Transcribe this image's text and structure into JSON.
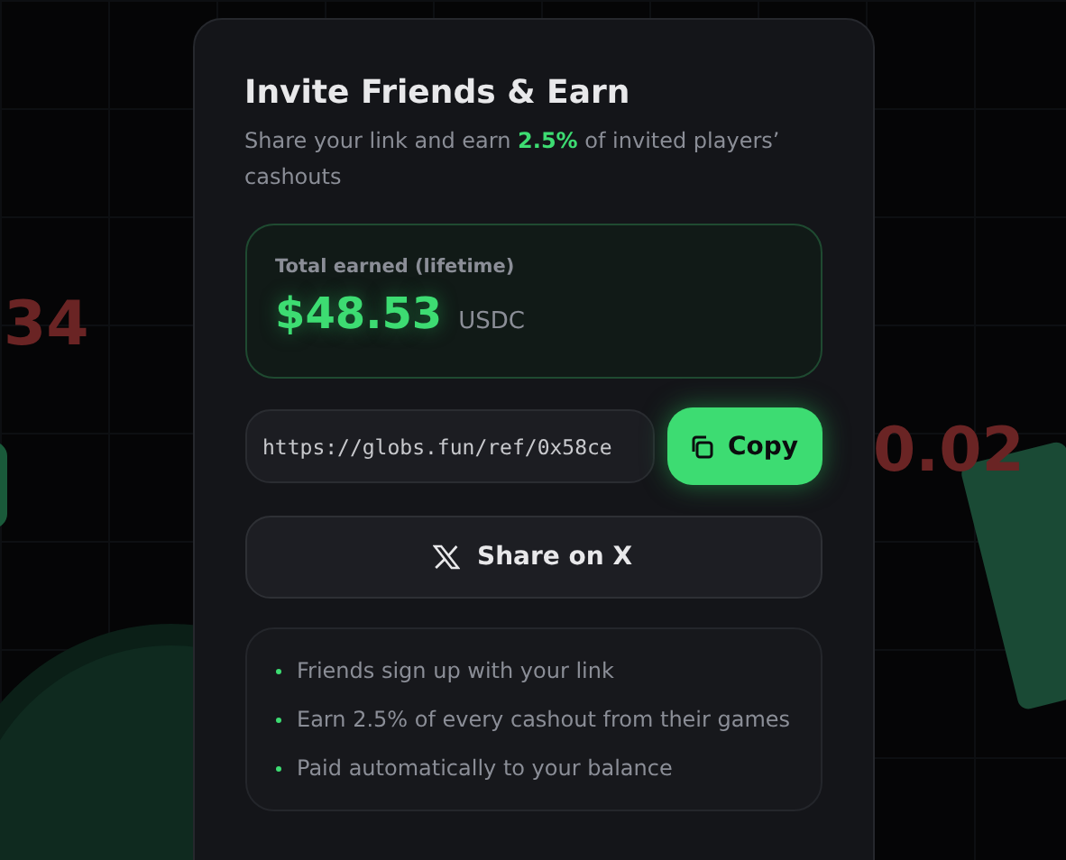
{
  "background": {
    "numbers": [
      "34",
      "0.02"
    ]
  },
  "card": {
    "title": "Invite Friends & Earn",
    "subtitle": "Share your link and earn **2.5%** of invited players’ cashouts",
    "earned": {
      "label": "Total earned (lifetime)",
      "amount": "$48.53",
      "currency": "USDC"
    },
    "link": {
      "value": "https://globs.fun/ref/0x58ce"
    },
    "copy_button": "Copy",
    "share_button": "Share on X",
    "steps": [
      "Friends sign up with your link",
      "Earn 2.5% of every cashout from their games",
      "Paid automatically to your balance"
    ]
  }
}
